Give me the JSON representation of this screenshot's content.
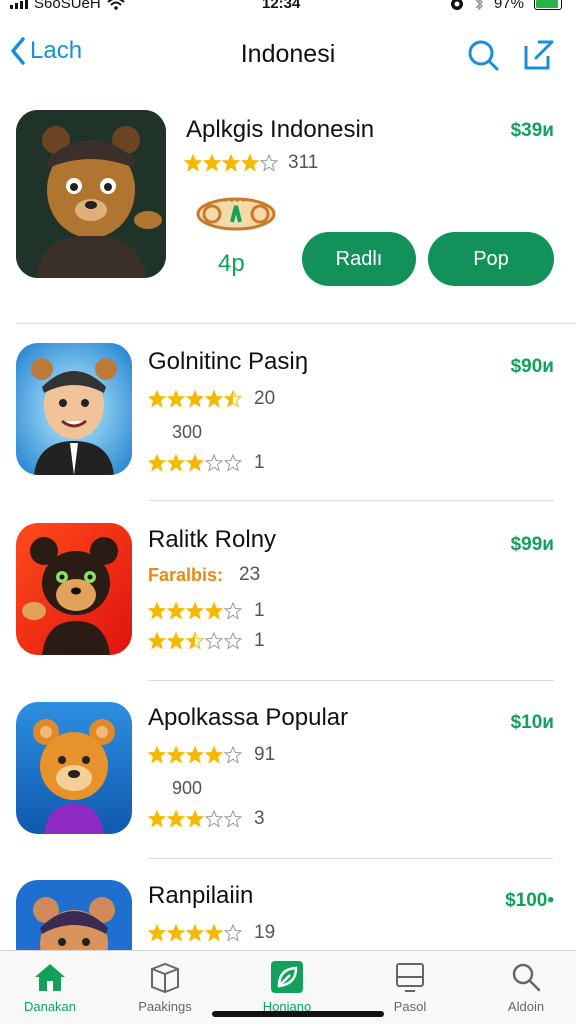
{
  "status_bar": {
    "carrier": "S6oSUeH",
    "time": "12:34",
    "battery": "97%",
    "battery_level": 0.97
  },
  "navbar": {
    "back_label": "Lach",
    "title": "Indonesi"
  },
  "featured": {
    "name": "Aplkgis Indonesin",
    "price": "$39и",
    "rating": 4,
    "rating_count": "311",
    "age": "4p",
    "button_left": "Radlı",
    "button_right": "Pop"
  },
  "list": [
    {
      "name": "Golnitinc Pasiŋ",
      "price": "$90и",
      "rating": 4.5,
      "rating_count": "20",
      "sub": "300",
      "sub_style": "plain",
      "rating2": 3,
      "rating2_count": "1"
    },
    {
      "name": "Ralitk Rolny",
      "price": "$99и",
      "rating": 4,
      "rating_count": "1",
      "sub": "Faralbis:",
      "sub_count": "23",
      "sub_style": "orange",
      "rating2": 2.5,
      "rating2_count": "1"
    },
    {
      "name": "Apolkassa Popular",
      "price": "$10и",
      "rating": 4,
      "rating_count": "91",
      "sub": "900",
      "sub_style": "plain",
      "rating2": 3,
      "rating2_count": "3"
    },
    {
      "name": "Ranpilaiin",
      "price": "$100•",
      "rating": 4,
      "rating_count": "19"
    }
  ],
  "tabs": [
    {
      "label": "Danakan",
      "icon": "home-icon",
      "active": true
    },
    {
      "label": "Paakings",
      "icon": "box-icon",
      "active": false
    },
    {
      "label": "Honiano",
      "icon": "leaf-icon",
      "active": true
    },
    {
      "label": "Pasol",
      "icon": "monitor-icon",
      "active": false
    },
    {
      "label": "Aldoin",
      "icon": "search-icon",
      "active": false
    }
  ],
  "colors": {
    "accent_green": "#13a05a",
    "button_green": "#12925a",
    "link_blue": "#1a8fd8",
    "star": "#f5b800"
  }
}
